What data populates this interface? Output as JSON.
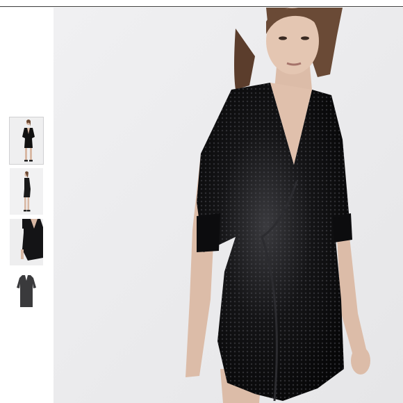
{
  "page": {
    "background_color": "#ffffff",
    "divider_color": "#3a3a3a"
  },
  "gallery": {
    "thumbnails": [
      {
        "icon": "model-front-view-thumbnail",
        "selected": true
      },
      {
        "icon": "model-side-view-thumbnail",
        "selected": false
      },
      {
        "icon": "dress-closeup-thumbnail",
        "selected": false
      },
      {
        "icon": "dress-flatlay-thumbnail",
        "selected": false
      }
    ],
    "main_image": {
      "icon": "black-sequin-wrap-dress-photo",
      "backdrop_color": "#ececee",
      "garment_color": "#0e0e10"
    }
  }
}
